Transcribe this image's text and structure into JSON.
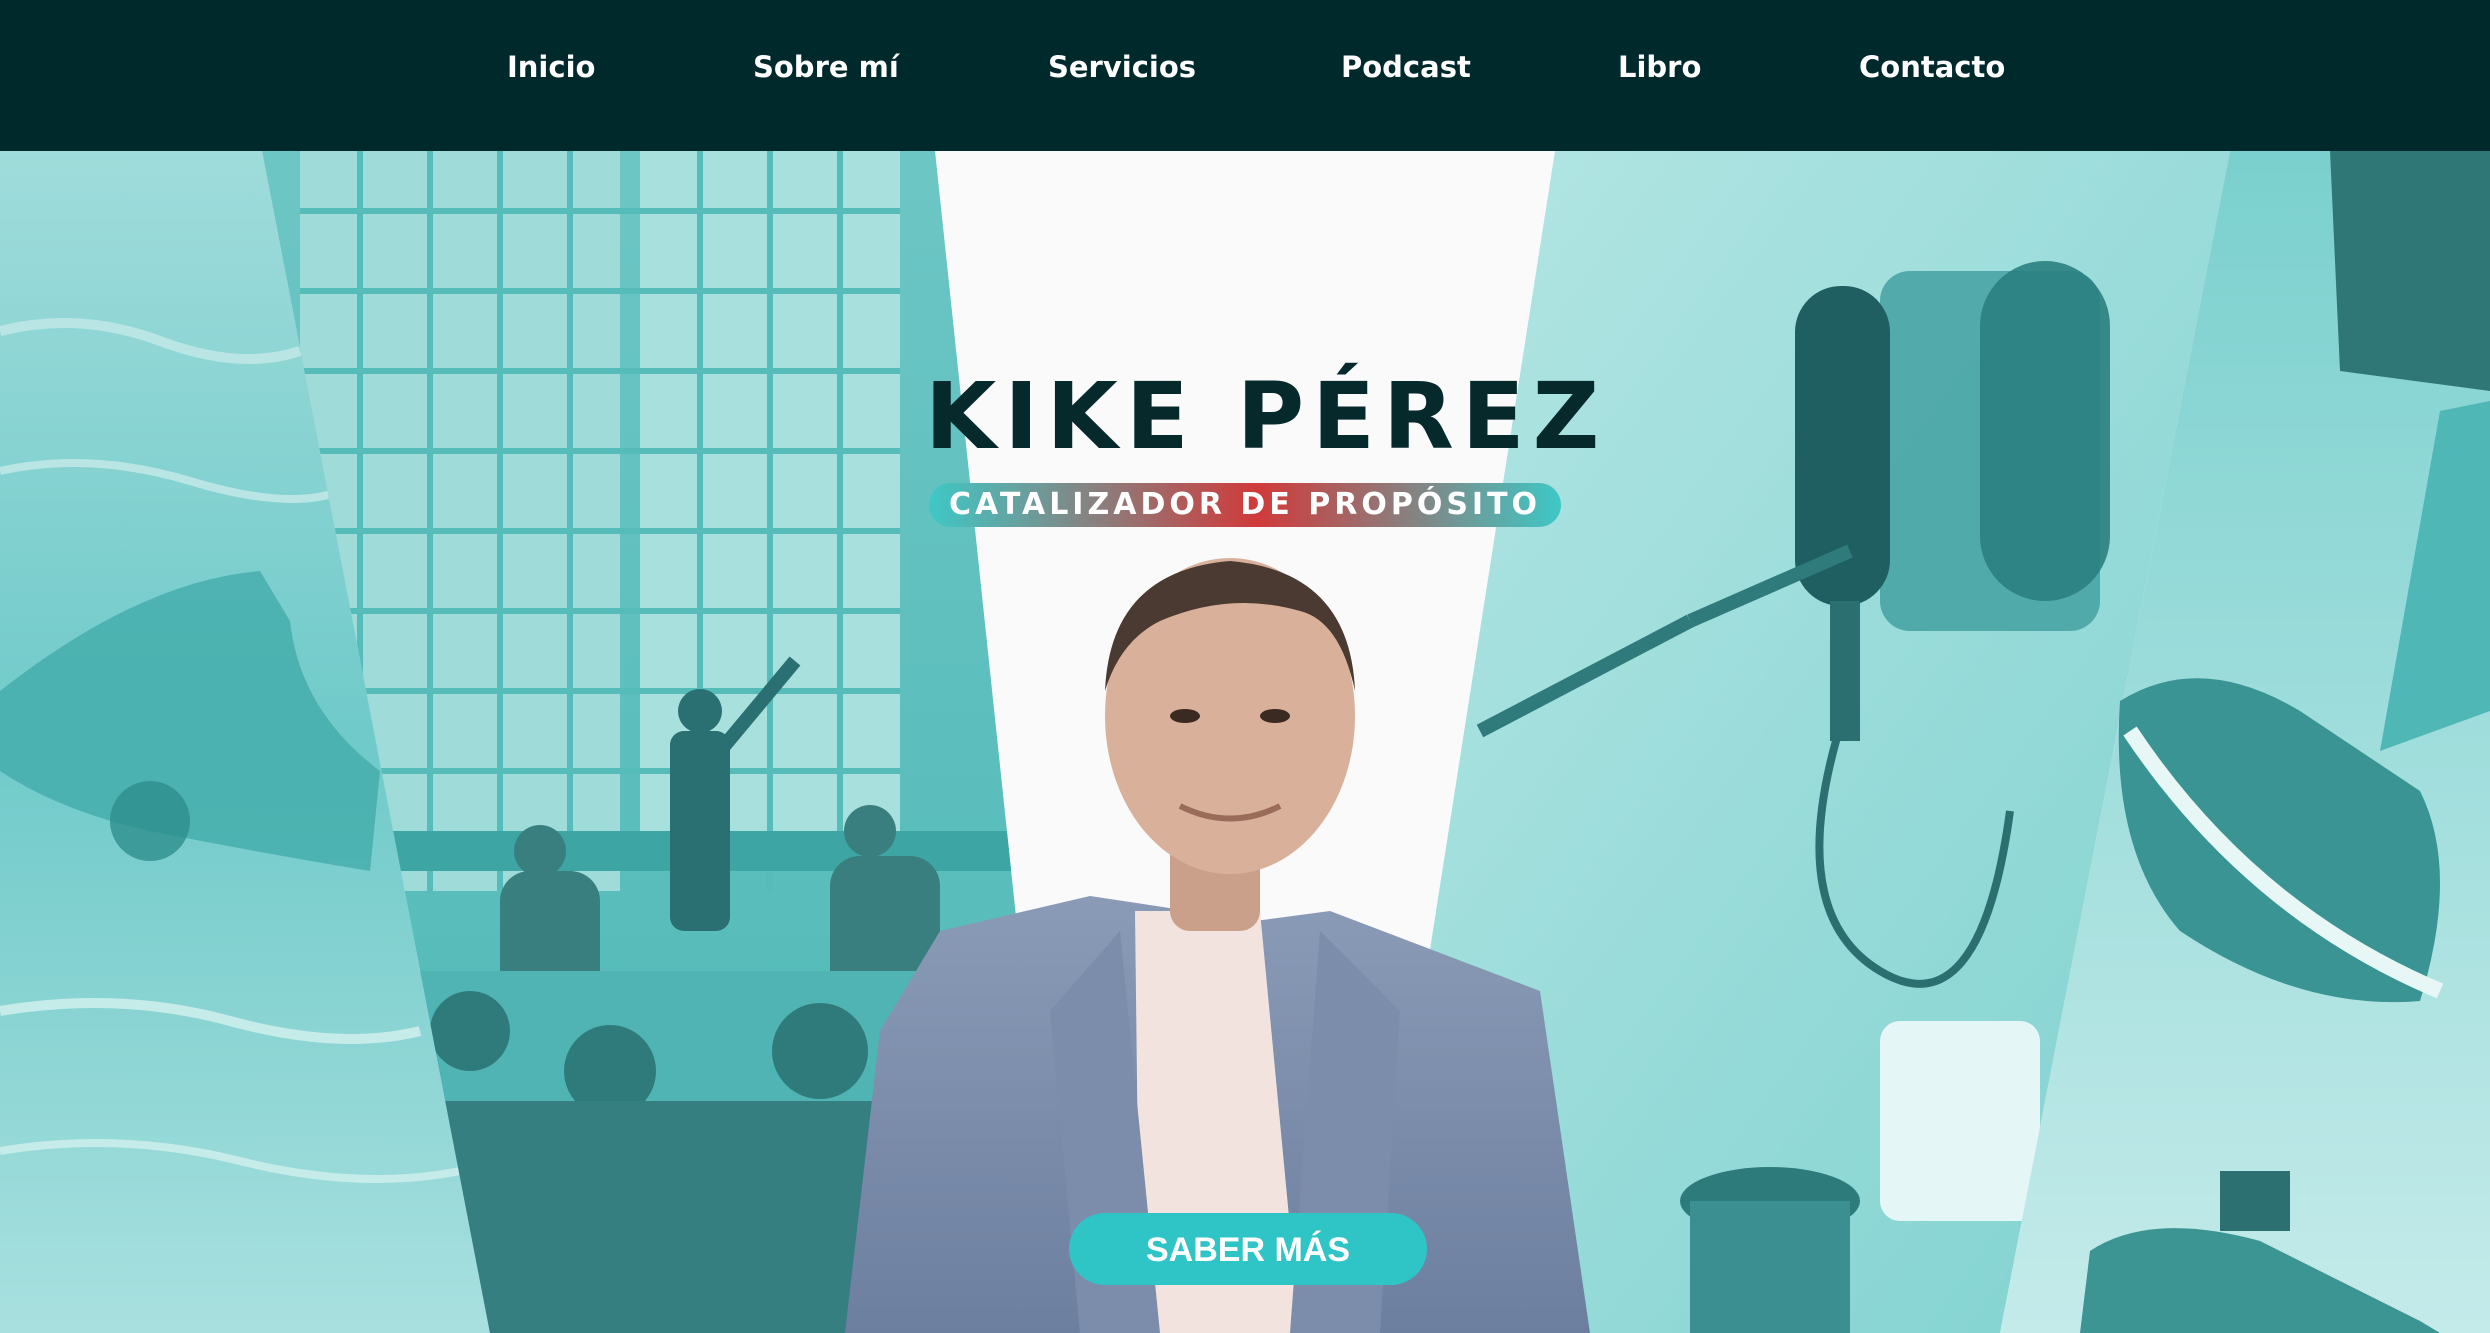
{
  "nav": {
    "items": [
      {
        "label": "Inicio"
      },
      {
        "label": "Sobre mí"
      },
      {
        "label": "Servicios"
      },
      {
        "label": "Podcast"
      },
      {
        "label": "Libro"
      },
      {
        "label": "Contacto"
      }
    ]
  },
  "hero": {
    "brand_name": "KIKE PÉREZ",
    "brand_tagline": "CATALIZADOR DE PROPÓSITO",
    "cta_label": "SABER MÁS",
    "panels": [
      "swimmer-photo",
      "office-meeting-photo",
      "podcast-microphone-photo",
      "runner-shoes-photo"
    ],
    "portrait": "man-in-blazer-portrait"
  },
  "colors": {
    "nav_bg": "#00292c",
    "accent_teal": "#2fc5c6",
    "tint_teal": "#5cc9c7",
    "brand_dark": "#062a2c",
    "tagline_red": "#d13a3a"
  }
}
